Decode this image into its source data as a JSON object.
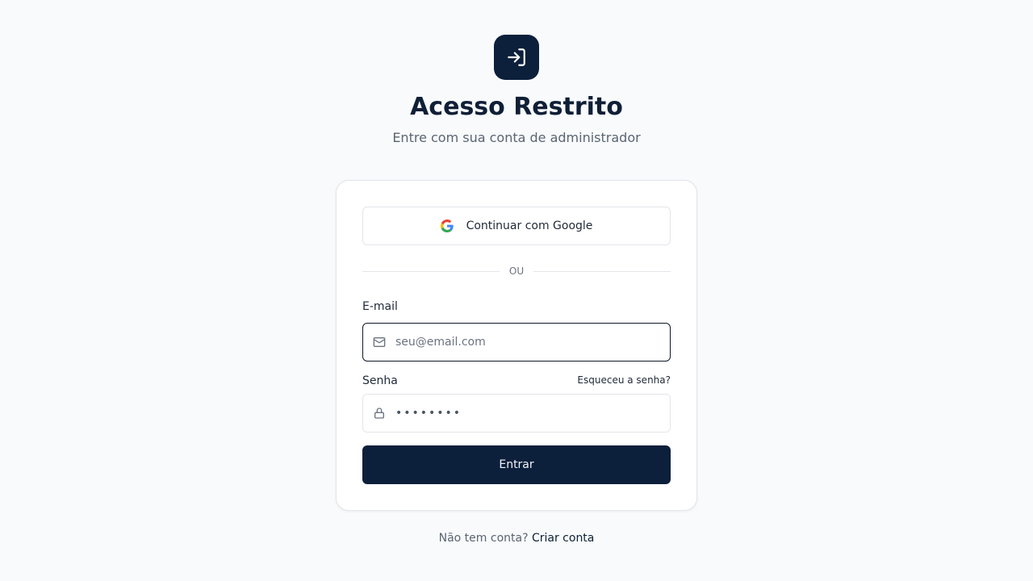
{
  "header": {
    "logo_icon": "sign-in-icon",
    "title": "Acesso Restrito",
    "subtitle": "Entre com sua conta de administrador"
  },
  "card": {
    "google_button": {
      "label": "Continuar com Google",
      "icon": "google-icon"
    },
    "divider_text": "OU",
    "email": {
      "label": "E-mail",
      "value": "",
      "placeholder": "seu@email.com",
      "icon": "mail-icon"
    },
    "password": {
      "label": "Senha",
      "forgot_link": "Esqueceu a senha?",
      "value": "••••••••",
      "icon": "lock-icon"
    },
    "submit_label": "Entrar"
  },
  "footer": {
    "prompt": "Não tem conta?",
    "link": "Criar conta"
  },
  "colors": {
    "brand_dark": "#0c1f3b",
    "background": "#f8fafc",
    "card": "#ffffff",
    "border": "#e2e5ea",
    "muted_text": "#5b6472"
  }
}
